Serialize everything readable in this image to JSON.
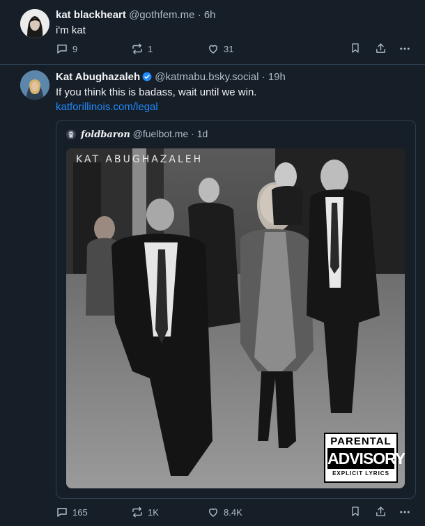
{
  "colors": {
    "background": "#161e27",
    "text": "#f1f3f5",
    "muted": "#aebbc9",
    "link": "#208bfe",
    "border": "#2e4052",
    "verified": "#208bfe"
  },
  "post1": {
    "name": "kat blackheart",
    "handle": "@gothfem.me",
    "separator": "·",
    "time": "6h",
    "text": "i'm kat",
    "replies": "9",
    "reposts": "1",
    "likes": "31"
  },
  "post2": {
    "name": "Kat Abughazaleh",
    "verified_icon": "verified-check-icon",
    "handle": "@katmabu.bsky.social",
    "separator": "·",
    "time": "19h",
    "text": "If you think this is badass, wait until we win.",
    "link": "katforillinois.com/legal",
    "replies": "165",
    "reposts": "1K",
    "likes": "8.4K",
    "quote": {
      "name": "foldbaron",
      "handle": "@fuelbot.me",
      "separator": "·",
      "time": "1d",
      "image": {
        "title": "KAT ABUGHAZALEH",
        "advisory_top": "PARENTAL",
        "advisory_mid": "ADVISORY",
        "advisory_bot": "EXPLICIT LYRICS"
      }
    }
  }
}
